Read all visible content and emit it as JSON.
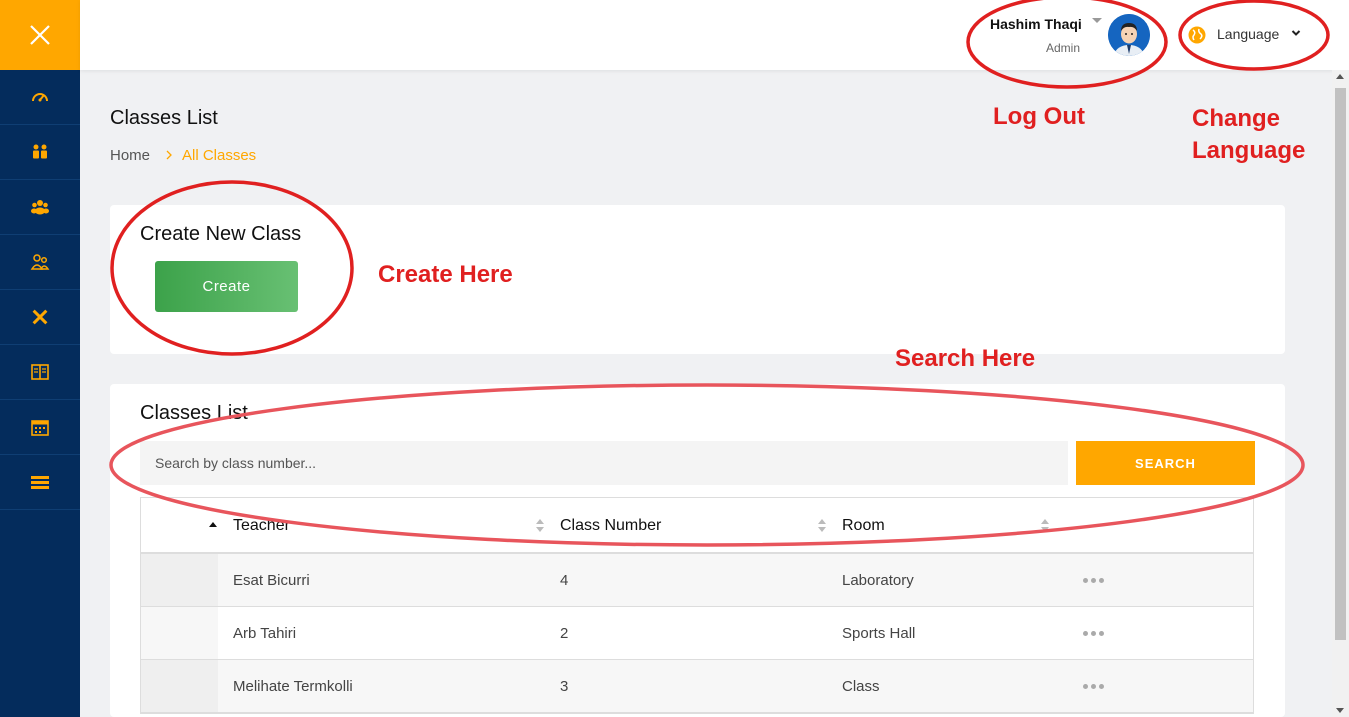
{
  "sidebar": {
    "toggle_icon": "close-icon",
    "items": [
      {
        "icon": "dashboard-icon"
      },
      {
        "icon": "students-icon"
      },
      {
        "icon": "groups-icon"
      },
      {
        "icon": "parents-icon"
      },
      {
        "icon": "tools-icon"
      },
      {
        "icon": "book-icon"
      },
      {
        "icon": "calendar-icon"
      },
      {
        "icon": "classes-icon"
      }
    ]
  },
  "header": {
    "user_name": "Hashim Thaqi",
    "user_role": "Admin",
    "language_label": "Language"
  },
  "page": {
    "title": "Classes List",
    "breadcrumb": {
      "home": "Home",
      "current": "All Classes"
    }
  },
  "create_card": {
    "title": "Create New Class",
    "button_label": "Create"
  },
  "list_card": {
    "title": "Classes List",
    "search_placeholder": "Search by class number...",
    "search_button": "SEARCH",
    "columns": [
      "Teacher",
      "Class Number",
      "Room"
    ],
    "rows": [
      {
        "teacher": "Esat Bicurri",
        "class_number": "4",
        "room": "Laboratory"
      },
      {
        "teacher": "Arb Tahiri",
        "class_number": "2",
        "room": "Sports Hall"
      },
      {
        "teacher": "Melihate Termkolli",
        "class_number": "3",
        "room": "Class"
      }
    ]
  },
  "annotations": {
    "logout": "Log Out",
    "change_language_1": "Change",
    "change_language_2": "Language",
    "create_here": "Create Here",
    "search_here": "Search Here"
  },
  "colors": {
    "sidebar": "#042c5c",
    "accent": "#ffa700",
    "create_button": "#3ca24a",
    "annotation": "#e02020"
  }
}
